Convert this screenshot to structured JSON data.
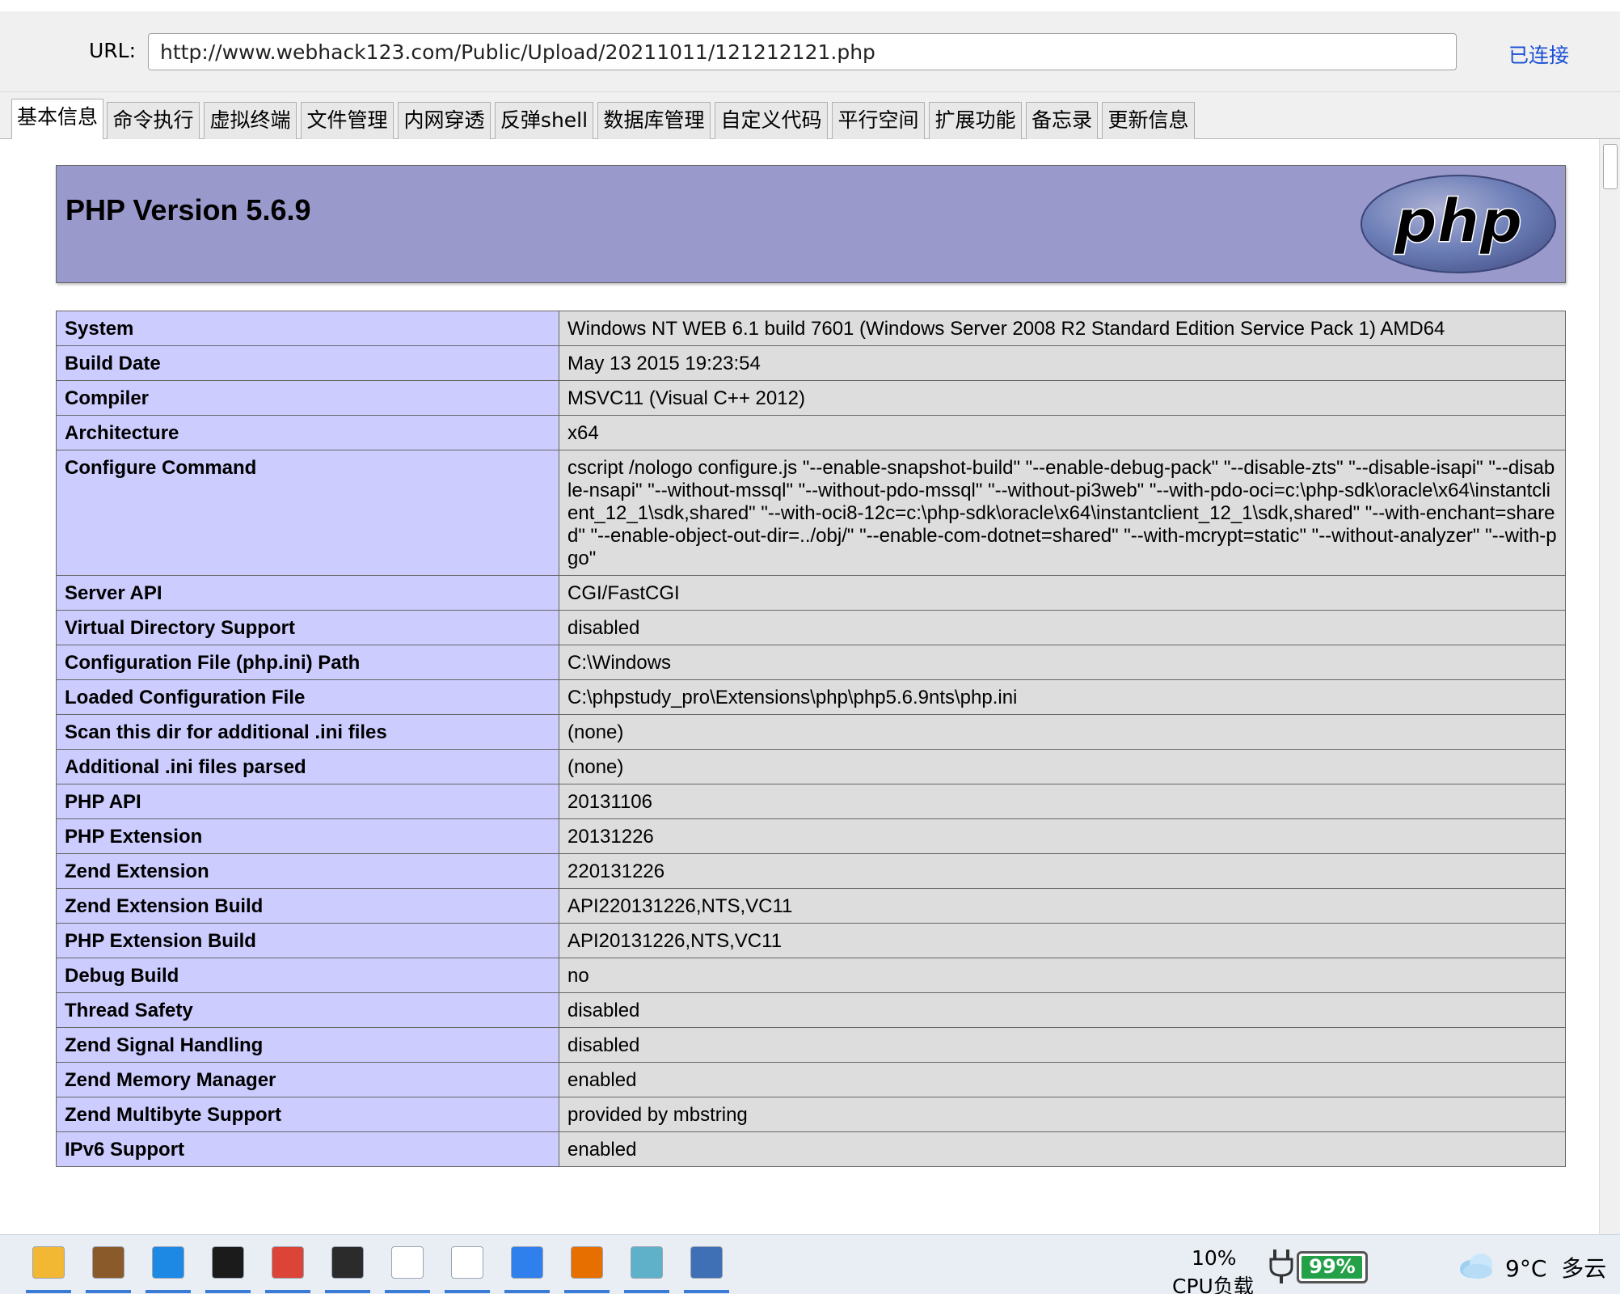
{
  "address_bar": {
    "label": "URL:",
    "url": "http://www.webhack123.com/Public/Upload/20211011/121212121.php",
    "status": "已连接"
  },
  "tabs": [
    {
      "label": "基本信息",
      "active": true
    },
    {
      "label": "命令执行",
      "active": false
    },
    {
      "label": "虚拟终端",
      "active": false
    },
    {
      "label": "文件管理",
      "active": false
    },
    {
      "label": "内网穿透",
      "active": false
    },
    {
      "label": "反弹shell",
      "active": false
    },
    {
      "label": "数据库管理",
      "active": false
    },
    {
      "label": "自定义代码",
      "active": false
    },
    {
      "label": "平行空间",
      "active": false
    },
    {
      "label": "扩展功能",
      "active": false
    },
    {
      "label": "备忘录",
      "active": false
    },
    {
      "label": "更新信息",
      "active": false
    }
  ],
  "phpinfo": {
    "title": "PHP Version 5.6.9",
    "logo_text": "php",
    "rows": [
      {
        "key": "System",
        "value": "Windows NT WEB 6.1 build 7601 (Windows Server 2008 R2 Standard Edition Service Pack 1) AMD64"
      },
      {
        "key": "Build Date",
        "value": "May 13 2015 19:23:54"
      },
      {
        "key": "Compiler",
        "value": "MSVC11 (Visual C++ 2012)"
      },
      {
        "key": "Architecture",
        "value": "x64"
      },
      {
        "key": "Configure Command",
        "value": "cscript /nologo configure.js \"--enable-snapshot-build\" \"--enable-debug-pack\" \"--disable-zts\" \"--disable-isapi\" \"--disable-nsapi\" \"--without-mssql\" \"--without-pdo-mssql\" \"--without-pi3web\" \"--with-pdo-oci=c:\\php-sdk\\oracle\\x64\\instantclient_12_1\\sdk,shared\" \"--with-oci8-12c=c:\\php-sdk\\oracle\\x64\\instantclient_12_1\\sdk,shared\" \"--with-enchant=shared\" \"--enable-object-out-dir=../obj/\" \"--enable-com-dotnet=shared\" \"--with-mcrypt=static\" \"--without-analyzer\" \"--with-pgo\""
      },
      {
        "key": "Server API",
        "value": "CGI/FastCGI"
      },
      {
        "key": "Virtual Directory Support",
        "value": "disabled"
      },
      {
        "key": "Configuration File (php.ini) Path",
        "value": "C:\\Windows"
      },
      {
        "key": "Loaded Configuration File",
        "value": "C:\\phpstudy_pro\\Extensions\\php\\php5.6.9nts\\php.ini"
      },
      {
        "key": "Scan this dir for additional .ini files",
        "value": "(none)"
      },
      {
        "key": "Additional .ini files parsed",
        "value": "(none)"
      },
      {
        "key": "PHP API",
        "value": "20131106"
      },
      {
        "key": "PHP Extension",
        "value": "20131226"
      },
      {
        "key": "Zend Extension",
        "value": "220131226"
      },
      {
        "key": "Zend Extension Build",
        "value": "API220131226,NTS,VC11"
      },
      {
        "key": "PHP Extension Build",
        "value": "API20131226,NTS,VC11"
      },
      {
        "key": "Debug Build",
        "value": "no"
      },
      {
        "key": "Thread Safety",
        "value": "disabled"
      },
      {
        "key": "Zend Signal Handling",
        "value": "disabled"
      },
      {
        "key": "Zend Memory Manager",
        "value": "enabled"
      },
      {
        "key": "Zend Multibyte Support",
        "value": "provided by mbstring"
      },
      {
        "key": "IPv6 Support",
        "value": "enabled"
      }
    ]
  },
  "taskbar": {
    "apps": [
      {
        "name": "file-explorer-icon",
        "color": "#f2b733"
      },
      {
        "name": "app-avatar-icon",
        "color": "#8a5a2b"
      },
      {
        "name": "virtual-machine-icon",
        "color": "#1e88e5"
      },
      {
        "name": "command-prompt-icon",
        "color": "#1b1b1b"
      },
      {
        "name": "chrome-icon",
        "color": "#db4437"
      },
      {
        "name": "terminal-icon",
        "color": "#2b2b2b"
      },
      {
        "name": "blank-document-icon",
        "color": "#ffffff"
      },
      {
        "name": "typora-icon",
        "color": "#ffffff"
      },
      {
        "name": "paint-icon",
        "color": "#2f80ed"
      },
      {
        "name": "java-icon",
        "color": "#e76f00"
      },
      {
        "name": "notepad-icon",
        "color": "#5fb0c9"
      },
      {
        "name": "network-tool-icon",
        "color": "#3f6fb5"
      }
    ],
    "cpu_percent": "10%",
    "cpu_label": "CPU负载",
    "battery_percent": "99%",
    "battery_level": 0.99,
    "weather_temp": "9°C",
    "weather_desc": "多云"
  },
  "colors": {
    "phpinfo_header": "#9999cc",
    "phpinfo_key_cell": "#ccccff",
    "phpinfo_value_cell": "#dddddd",
    "link_blue": "#1a4fd6",
    "battery_green": "#24a148"
  }
}
